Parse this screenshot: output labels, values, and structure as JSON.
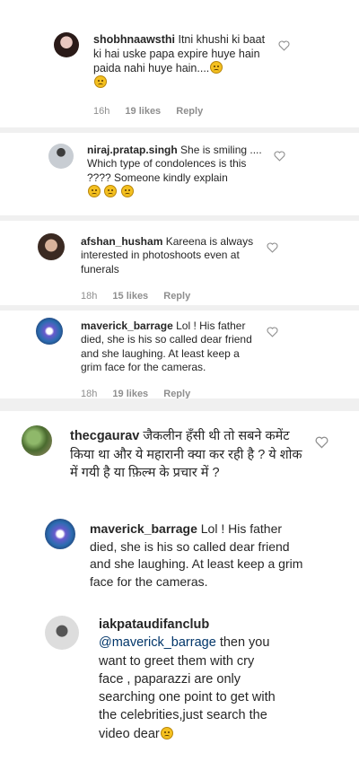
{
  "comments": [
    {
      "username": "shobhnaawsthi",
      "text": "Itni khushi ki baat ki hai uske papa expire huye hain paida nahi huye hain....",
      "time": "16h",
      "likes": "19 likes",
      "reply": "Reply"
    },
    {
      "username": "niraj.pratap.singh",
      "text": "She is smiling .... Which type of condolences is this ???? Someone kindly explain"
    },
    {
      "username": "afshan_husham",
      "text": "Kareena is always interested in photoshoots even at funerals",
      "time": "18h",
      "likes": "15 likes",
      "reply": "Reply"
    },
    {
      "username": "maverick_barrage",
      "text": "Lol ! His father died, she is his so called dear friend and she laughing. At least keep a grim face for the cameras.",
      "time": "18h",
      "likes": "19 likes",
      "reply": "Reply"
    },
    {
      "username": "thecgaurav",
      "text": "जैकलीन हँसी थी तो सबने कमेंट किया था और ये महारानी क्या कर रही है ? ये शोक में गयी है या फ़िल्म के प्रचार में ?"
    },
    {
      "username": "maverick_barrage",
      "text": "Lol ! His father died, she is his so called dear friend and she laughing. At least keep a grim face for the cameras."
    },
    {
      "username": "iakpataudifanclub",
      "mention": "@maverick_barrage",
      "text": "then you want to greet them with cry face , paparazzi are only searching one point to get with the celebrities,just search the video dear"
    }
  ],
  "icons": {
    "heart": "heart-outline-icon",
    "emoji_smile": "slightly-smiling-face-emoji",
    "emoji_sad": "confused-face-emoji",
    "emoji_hands": "hands-over-face-emoji"
  },
  "colors": {
    "text": "#262626",
    "meta": "#8e8e8e",
    "mention": "#003569"
  }
}
